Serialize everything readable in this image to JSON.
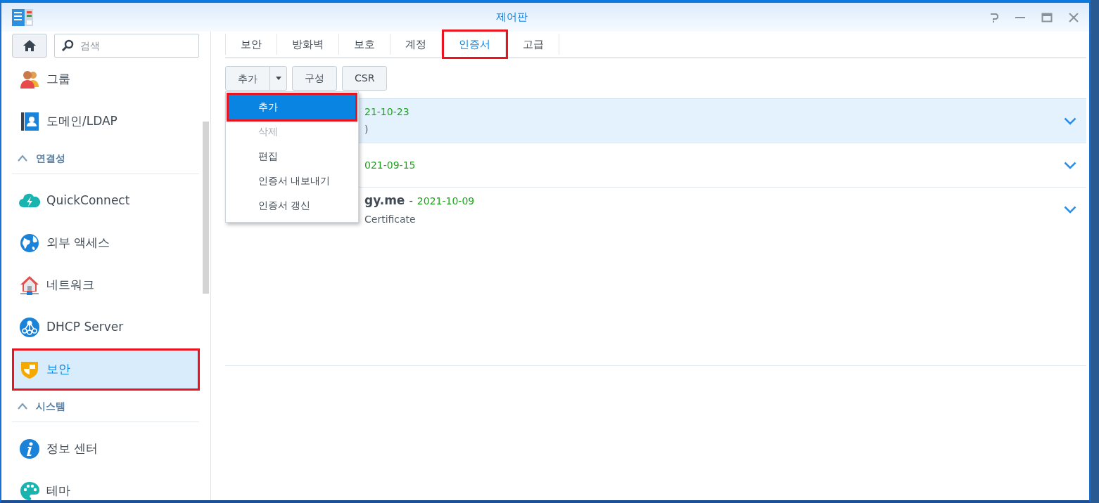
{
  "window": {
    "title": "제어판"
  },
  "search": {
    "placeholder": "검색"
  },
  "sidebar": {
    "items": [
      {
        "kind": "item",
        "label": "그룹",
        "selected": false,
        "highlighted": false
      },
      {
        "kind": "item",
        "label": "도메인/LDAP",
        "selected": false,
        "highlighted": false
      },
      {
        "kind": "header",
        "label": "연결성",
        "expanded": true
      },
      {
        "kind": "item",
        "label": "QuickConnect",
        "selected": false,
        "highlighted": false
      },
      {
        "kind": "item",
        "label": "외부 액세스",
        "selected": false,
        "highlighted": false
      },
      {
        "kind": "item",
        "label": "네트워크",
        "selected": false,
        "highlighted": false
      },
      {
        "kind": "item",
        "label": "DHCP Server",
        "selected": false,
        "highlighted": false
      },
      {
        "kind": "item",
        "label": "보안",
        "selected": true,
        "highlighted": true
      },
      {
        "kind": "header",
        "label": "시스템",
        "expanded": true
      },
      {
        "kind": "item",
        "label": "정보 센터",
        "selected": false,
        "highlighted": false
      },
      {
        "kind": "item",
        "label": "테마",
        "selected": false,
        "highlighted": false
      }
    ]
  },
  "tabs": [
    {
      "label": "보안",
      "selected": false,
      "highlighted": false
    },
    {
      "label": "방화벽",
      "selected": false,
      "highlighted": false
    },
    {
      "label": "보호",
      "selected": false,
      "highlighted": false
    },
    {
      "label": "계정",
      "selected": false,
      "highlighted": false
    },
    {
      "label": "인증서",
      "selected": true,
      "highlighted": true
    },
    {
      "label": "고급",
      "selected": false,
      "highlighted": false
    }
  ],
  "toolbar": {
    "split_button": {
      "label": "추가"
    },
    "buttons": [
      "구성",
      "CSR"
    ]
  },
  "menu": {
    "items": [
      {
        "label": "추가",
        "selected": true,
        "disabled": false,
        "highlighted": true
      },
      {
        "label": "삭제",
        "selected": false,
        "disabled": true,
        "highlighted": false
      },
      {
        "label": "편집",
        "selected": false,
        "disabled": false,
        "highlighted": false
      },
      {
        "label": "인증서 내보내기",
        "selected": false,
        "disabled": false,
        "highlighted": false
      },
      {
        "label": "인증서 갱신",
        "selected": false,
        "disabled": false,
        "highlighted": false
      }
    ]
  },
  "certificates": [
    {
      "date": "21-10-23",
      "subtitle": ")",
      "selected": true
    },
    {
      "date": "021-09-15",
      "selected": false
    },
    {
      "title": "gy.me",
      "dash": "-",
      "date": "2021-10-09",
      "subtitle": "Certificate",
      "selected": false
    }
  ]
}
